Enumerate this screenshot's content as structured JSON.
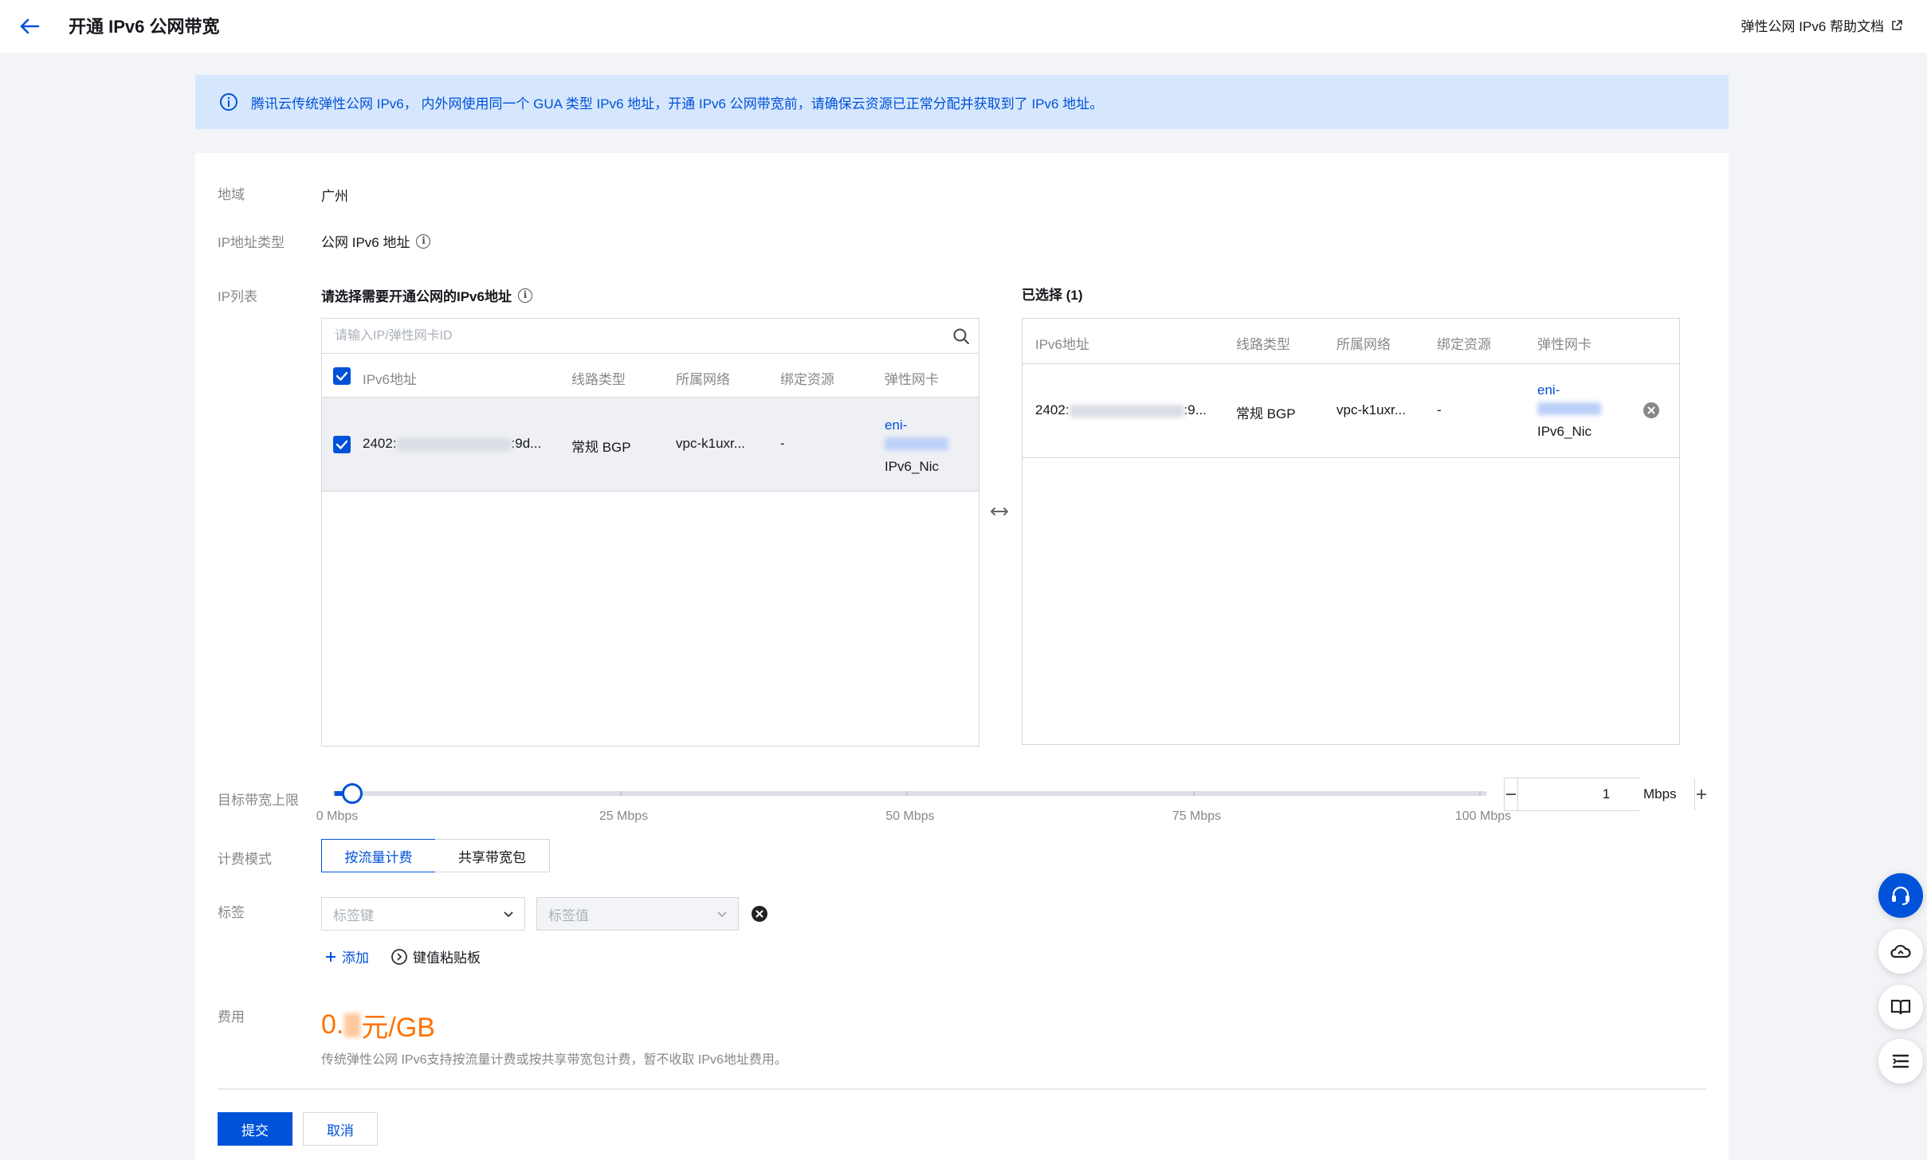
{
  "header": {
    "title": "开通 IPv6 公网带宽",
    "help_link": "弹性公网 IPv6 帮助文档"
  },
  "notice": {
    "text": "腾讯云传统弹性公网 IPv6， 内外网使用同一个 GUA 类型 IPv6 地址，开通 IPv6 公网带宽前，请确保云资源已正常分配并获取到了 IPv6 地址。"
  },
  "form": {
    "region_label": "地域",
    "region_value": "广州",
    "ip_type_label": "IP地址类型",
    "ip_type_value": "公网 IPv6 地址",
    "ip_list_label": "IP列表",
    "bandwidth_label": "目标带宽上限",
    "billing_label": "计费模式",
    "tag_label": "标签",
    "fee_label": "费用"
  },
  "left_panel": {
    "title": "请选择需要开通公网的IPv6地址",
    "search_placeholder": "请输入IP/弹性网卡ID",
    "columns": [
      "IPv6地址",
      "线路类型",
      "所属网络",
      "绑定资源",
      "弹性网卡"
    ],
    "rows": [
      {
        "ipv6_prefix": "2402:",
        "ipv6_suffix": ":9d...",
        "line_type": "常规 BGP",
        "network": "vpc-k1uxr...",
        "resource": "-",
        "eni_prefix": "eni-",
        "eni_name": "IPv6_Nic"
      }
    ]
  },
  "right_panel": {
    "title": "已选择 (1)",
    "columns": [
      "IPv6地址",
      "线路类型",
      "所属网络",
      "绑定资源",
      "弹性网卡"
    ],
    "rows": [
      {
        "ipv6_prefix": "2402:",
        "ipv6_suffix": ":9...",
        "line_type": "常规 BGP",
        "network": "vpc-k1uxr...",
        "resource": "-",
        "eni_prefix": "eni-",
        "eni_name": "IPv6_Nic"
      }
    ]
  },
  "bandwidth": {
    "value": 1,
    "min": 0,
    "max": 100,
    "ticks": [
      "0 Mbps",
      "25 Mbps",
      "50 Mbps",
      "75 Mbps",
      "100 Mbps"
    ],
    "unit": "Mbps",
    "stepper_value": "1"
  },
  "billing": {
    "options": [
      "按流量计费",
      "共享带宽包"
    ],
    "selected": "按流量计费"
  },
  "tags": {
    "key_placeholder": "标签键",
    "value_placeholder": "标签值",
    "add_label": "添加",
    "clipboard_label": "键值粘贴板"
  },
  "fee": {
    "price_prefix": "0.",
    "price_suffix": "元/GB",
    "note": "传统弹性公网 IPv6支持按流量计费或按共享带宽包计费，暂不收取 IPv6地址费用。"
  },
  "actions": {
    "submit": "提交",
    "cancel": "取消"
  },
  "colors": {
    "primary": "#0052d9",
    "price": "#ff7200",
    "notice_bg": "#d6e7fd"
  }
}
